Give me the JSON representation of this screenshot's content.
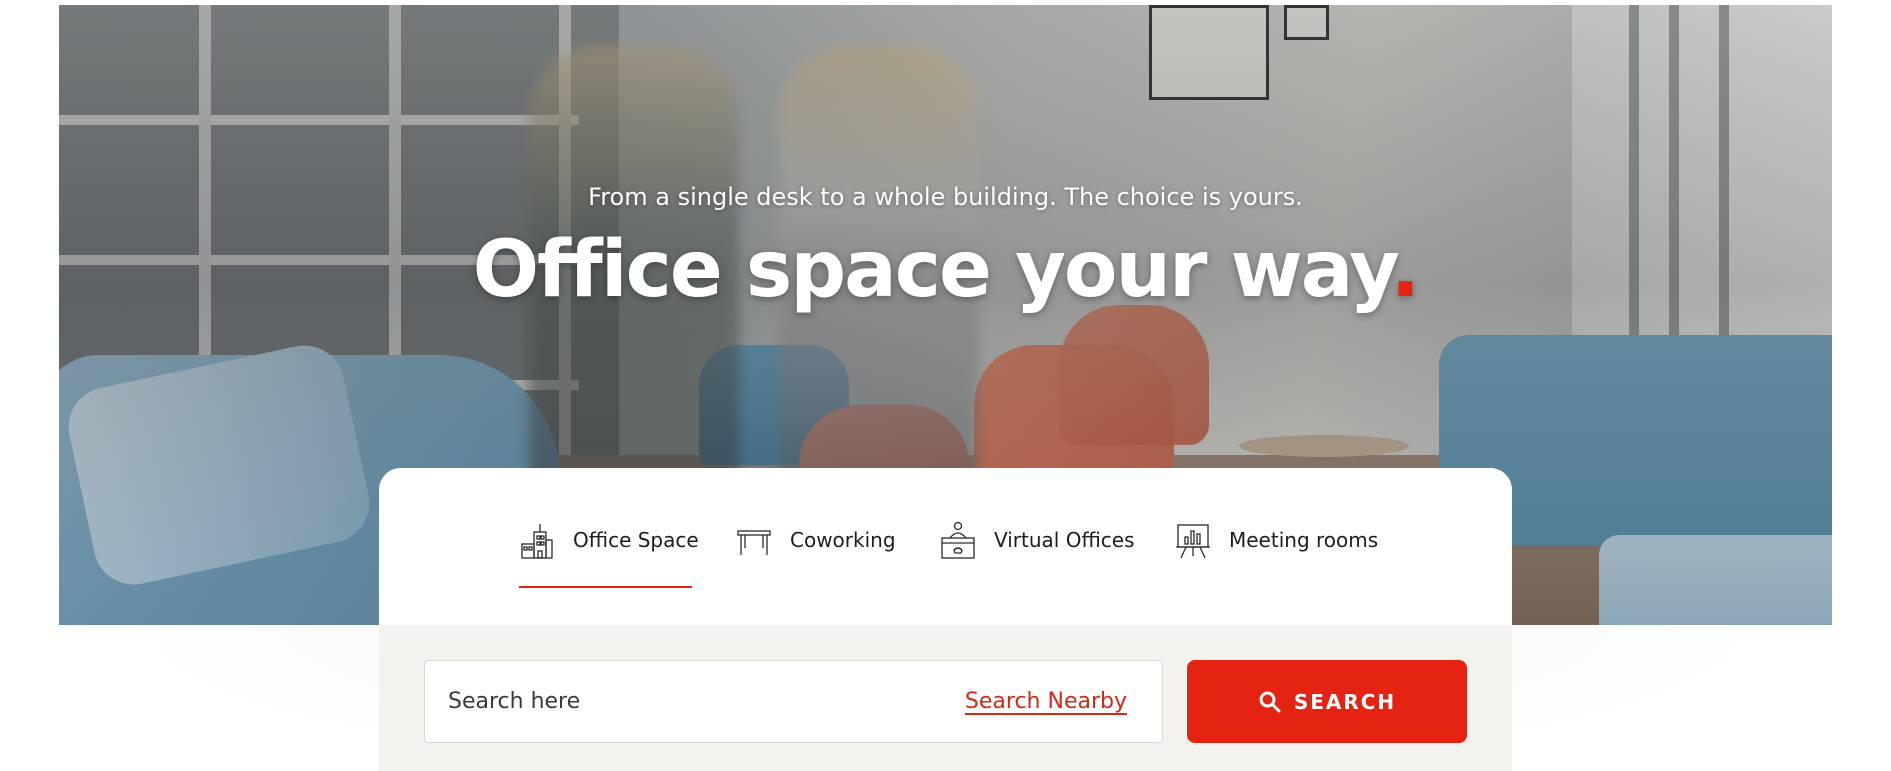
{
  "hero": {
    "subtitle": "From a single desk to a whole building. The choice is yours.",
    "headline": "Office space your way",
    "headline_dot": ".",
    "image": "office-lounge-photo",
    "accent_color": "#e42313"
  },
  "tabs": [
    {
      "label": "Office Space",
      "icon": "office-building-icon",
      "active": true
    },
    {
      "label": "Coworking",
      "icon": "desk-icon",
      "active": false
    },
    {
      "label": "Virtual Offices",
      "icon": "receptionist-desk-icon",
      "active": false
    },
    {
      "label": "Meeting rooms",
      "icon": "presentation-board-icon",
      "active": false
    }
  ],
  "search": {
    "placeholder": "Search here",
    "value": "",
    "nearby_label": "Search Nearby",
    "button_label": "SEARCH",
    "button_icon": "search-icon",
    "button_color": "#e42313"
  }
}
